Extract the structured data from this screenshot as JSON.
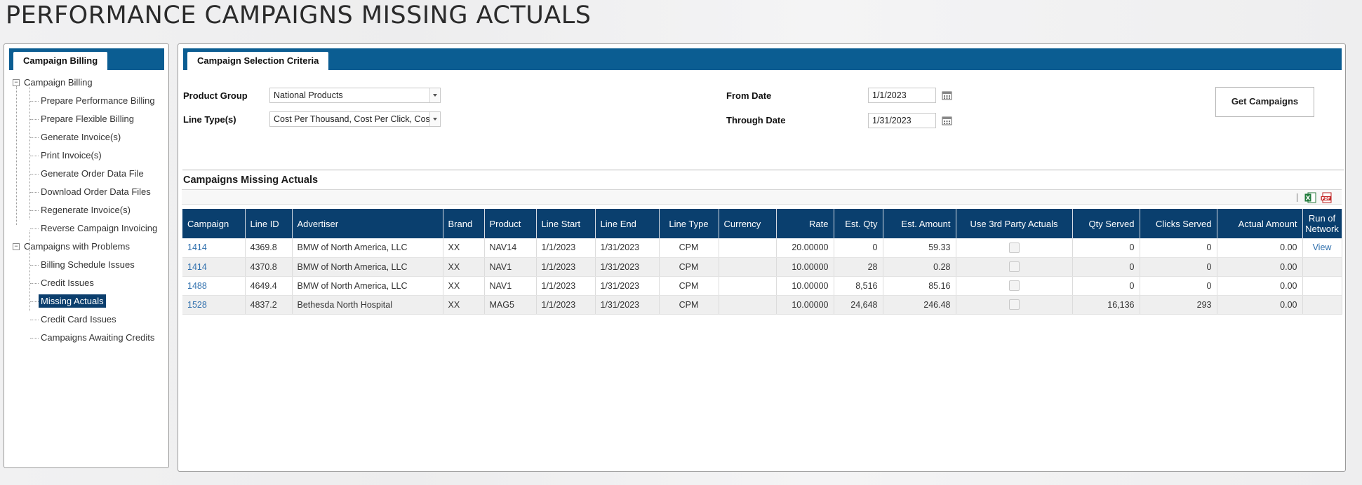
{
  "page_title": "PERFORMANCE CAMPAIGNS MISSING ACTUALS",
  "sidebar": {
    "tab_label": "Campaign Billing",
    "groups": [
      {
        "label": "Campaign Billing",
        "items": [
          "Prepare Performance Billing",
          "Prepare Flexible Billing",
          "Generate Invoice(s)",
          "Print Invoice(s)",
          "Generate Order Data File",
          "Download Order Data Files",
          "Regenerate Invoice(s)",
          "Reverse Campaign Invoicing"
        ]
      },
      {
        "label": "Campaigns with Problems",
        "items": [
          "Billing Schedule Issues",
          "Credit Issues",
          "Missing Actuals",
          "Credit Card Issues",
          "Campaigns Awaiting Credits"
        ]
      }
    ],
    "selected_item": "Missing Actuals"
  },
  "criteria": {
    "tab_label": "Campaign Selection Criteria",
    "product_group_label": "Product Group",
    "product_group_value": "National Products",
    "line_types_label": "Line Type(s)",
    "line_types_value": "Cost Per Thousand, Cost Per Click, Cost Per Day,",
    "from_date_label": "From Date",
    "from_date_value": "1/1/2023",
    "through_date_label": "Through Date",
    "through_date_value": "1/31/2023",
    "get_campaigns_label": "Get Campaigns"
  },
  "results": {
    "title": "Campaigns Missing Actuals",
    "columns": [
      "Campaign",
      "Line ID",
      "Advertiser",
      "Brand",
      "Product",
      "Line Start",
      "Line End",
      "Line Type",
      "Currency",
      "Rate",
      "Est. Qty",
      "Est. Amount",
      "Use 3rd Party Actuals",
      "Qty Served",
      "Clicks Served",
      "Actual Amount",
      "Run of Network"
    ],
    "rows": [
      {
        "campaign": "1414",
        "line_id": "4369.8",
        "advertiser": "BMW of North America, LLC",
        "brand": "XX",
        "product": "NAV14",
        "line_start": "1/1/2023",
        "line_end": "1/31/2023",
        "line_type": "CPM",
        "currency": "",
        "rate": "20.00000",
        "est_qty": "0",
        "est_amount": "59.33",
        "qty_served": "0",
        "clicks_served": "0",
        "actual_amount": "0.00",
        "run_of_network": "View"
      },
      {
        "campaign": "1414",
        "line_id": "4370.8",
        "advertiser": "BMW of North America, LLC",
        "brand": "XX",
        "product": "NAV1",
        "line_start": "1/1/2023",
        "line_end": "1/31/2023",
        "line_type": "CPM",
        "currency": "",
        "rate": "10.00000",
        "est_qty": "28",
        "est_amount": "0.28",
        "qty_served": "0",
        "clicks_served": "0",
        "actual_amount": "0.00",
        "run_of_network": ""
      },
      {
        "campaign": "1488",
        "line_id": "4649.4",
        "advertiser": "BMW of North America, LLC",
        "brand": "XX",
        "product": "NAV1",
        "line_start": "1/1/2023",
        "line_end": "1/31/2023",
        "line_type": "CPM",
        "currency": "",
        "rate": "10.00000",
        "est_qty": "8,516",
        "est_amount": "85.16",
        "qty_served": "0",
        "clicks_served": "0",
        "actual_amount": "0.00",
        "run_of_network": ""
      },
      {
        "campaign": "1528",
        "line_id": "4837.2",
        "advertiser": "Bethesda North Hospital",
        "brand": "XX",
        "product": "MAG5",
        "line_start": "1/1/2023",
        "line_end": "1/31/2023",
        "line_type": "CPM",
        "currency": "",
        "rate": "10.00000",
        "est_qty": "24,648",
        "est_amount": "246.48",
        "qty_served": "16,136",
        "clicks_served": "293",
        "actual_amount": "0.00",
        "run_of_network": ""
      }
    ]
  },
  "colors": {
    "header_blue": "#0a3f6e",
    "tabbar_blue": "#0b5d92",
    "link_blue": "#2f6fad"
  }
}
